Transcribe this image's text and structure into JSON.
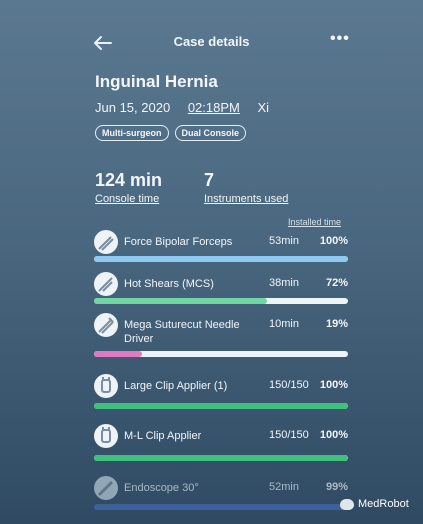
{
  "header": {
    "title": "Case details",
    "more": "•••"
  },
  "case": {
    "title": "Inguinal Hernia",
    "date": "Jun 15, 2020",
    "time": "02:18PM",
    "system": "Xi",
    "tags": [
      "Multi-surgeon",
      "Dual Console"
    ]
  },
  "stats": {
    "console": {
      "value": "124 min",
      "label": "Console time"
    },
    "instruments": {
      "value": "7",
      "label": "Instruments used"
    }
  },
  "list_header": "Installed time",
  "instruments": [
    {
      "name": "Force Bipolar Forceps",
      "mins": "53min",
      "pct": "100%",
      "fraction": 1.0,
      "color": "#8ec9f2",
      "icon": "forceps-icon"
    },
    {
      "name": "Hot Shears (MCS)",
      "mins": "38min",
      "pct": "72%",
      "fraction": 0.68,
      "color": "#6fd6a2",
      "icon": "shears-icon"
    },
    {
      "name": "Mega Suturecut Needle Driver",
      "mins": "10min",
      "pct": "19%",
      "fraction": 0.19,
      "color": "#e07ac0",
      "icon": "needle-driver-icon"
    },
    {
      "name": "Large Clip Applier (1)",
      "mins": "150/150",
      "pct": "100%",
      "fraction": 1.0,
      "color": "#40c07f",
      "icon": "clip-applier-icon"
    },
    {
      "name": "M-L Clip Applier",
      "mins": "150/150",
      "pct": "100%",
      "fraction": 1.0,
      "color": "#40c07f",
      "icon": "clip-applier-icon"
    },
    {
      "name": "Endoscope 30°",
      "mins": "52min",
      "pct": "99%",
      "fraction": 1.0,
      "color": "#3f65a7",
      "icon": "endoscope-icon"
    }
  ],
  "watermark": "MedRobot"
}
